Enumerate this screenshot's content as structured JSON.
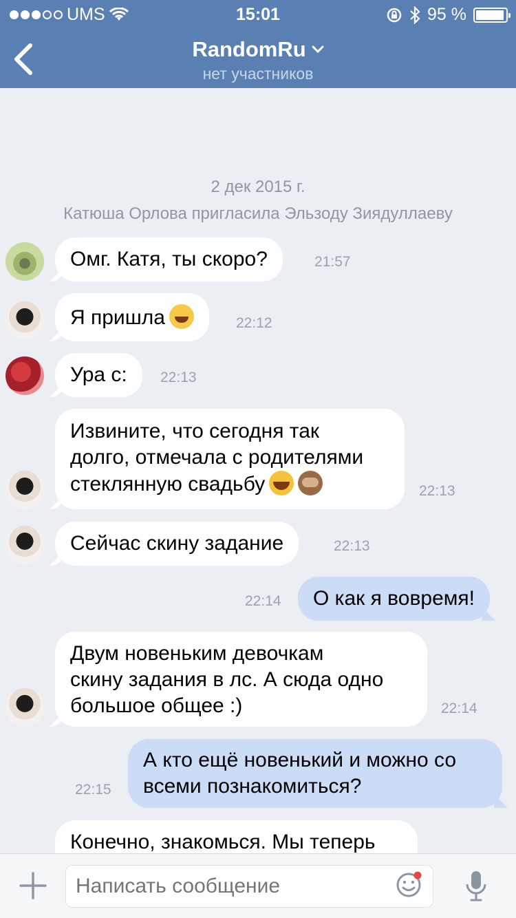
{
  "status": {
    "carrier": "UMS",
    "time": "15:01",
    "battery": "95 %",
    "battery_level": 0.95
  },
  "header": {
    "title": "RandomRu",
    "subtitle": "нет участников"
  },
  "system": {
    "date": "2 дек 2015 г.",
    "actor": "Катюша Орлова",
    "action": "пригласила",
    "target": "Эльзоду Зиядуллаеву"
  },
  "messages": [
    {
      "dir": "in",
      "lines": [
        "Омг. Катя, ты скоро?"
      ],
      "time": "21:57"
    },
    {
      "dir": "in",
      "lines": [
        "Я пришла"
      ],
      "emoji": [
        "grinning-face"
      ],
      "time": "22:12"
    },
    {
      "dir": "in",
      "lines": [
        "Ура с:"
      ],
      "time": "22:13"
    },
    {
      "dir": "in",
      "lines": [
        "Извините, что сегодня так",
        "долго, отмечала с родителями",
        "стеклянную свадьбу"
      ],
      "emoji": [
        "tears-of-joy-face",
        "see-no-evil-monkey"
      ],
      "time": "22:13"
    },
    {
      "dir": "in",
      "lines": [
        "Сейчас скину задание"
      ],
      "time": "22:13"
    },
    {
      "dir": "out",
      "lines": [
        "О как я вовремя!"
      ],
      "time": "22:14"
    },
    {
      "dir": "in",
      "lines": [
        "Двум новеньким девочкам",
        "скину задания в лс. А сюда одно",
        "большое общее :)"
      ],
      "time": "22:14"
    },
    {
      "dir": "out",
      "lines": [
        "А кто ещё новенький и можно со",
        "всеми познакомиться?"
      ],
      "time": "22:15"
    },
    {
      "dir": "in",
      "lines": [
        "Конечно, знакомься. Мы теперь"
      ],
      "time": ""
    }
  ],
  "composer": {
    "placeholder": "Написать сообщение"
  }
}
